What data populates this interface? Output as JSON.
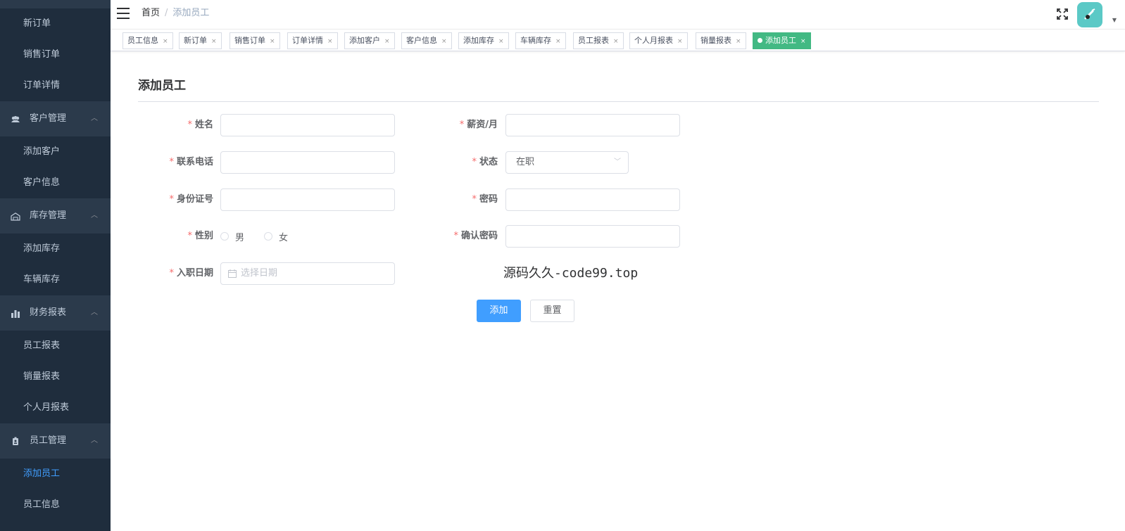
{
  "sidebar": {
    "items_top": [
      {
        "label": "新订单"
      },
      {
        "label": "销售订单"
      },
      {
        "label": "订单详情"
      }
    ],
    "group_customer": {
      "label": "客户管理",
      "icon": "users-icon"
    },
    "customer_items": [
      {
        "label": "添加客户"
      },
      {
        "label": "客户信息"
      }
    ],
    "group_inventory": {
      "label": "库存管理",
      "icon": "warehouse-icon"
    },
    "inventory_items": [
      {
        "label": "添加库存"
      },
      {
        "label": "车辆库存"
      }
    ],
    "group_finance": {
      "label": "财务报表",
      "icon": "bar-chart-icon"
    },
    "finance_items": [
      {
        "label": "员工报表"
      },
      {
        "label": "销量报表"
      },
      {
        "label": "个人月报表"
      }
    ],
    "group_employee": {
      "label": "员工管理",
      "icon": "badge-icon"
    },
    "employee_items": [
      {
        "label": "添加员工",
        "active": true
      },
      {
        "label": "员工信息"
      }
    ]
  },
  "navbar": {
    "breadcrumb_home": "首页",
    "breadcrumb_sep": "/",
    "breadcrumb_current": "添加员工"
  },
  "tags": [
    {
      "label": "员工信息",
      "close": "×"
    },
    {
      "label": "新订单",
      "close": "×"
    },
    {
      "label": "销售订单",
      "close": "×"
    },
    {
      "label": "订单详情",
      "close": "×"
    },
    {
      "label": "添加客户",
      "close": "×"
    },
    {
      "label": "客户信息",
      "close": "×"
    },
    {
      "label": "添加库存",
      "close": "×"
    },
    {
      "label": "车辆库存",
      "close": "×"
    },
    {
      "label": "员工报表",
      "close": "×"
    },
    {
      "label": "个人月报表",
      "close": "×"
    },
    {
      "label": "销量报表",
      "close": "×"
    },
    {
      "label": "添加员工",
      "close": "×",
      "active": true
    }
  ],
  "form": {
    "title": "添加员工",
    "required_mark": "*",
    "name_label": "姓名",
    "name_value": "",
    "phone_label": "联系电话",
    "phone_value": "",
    "id_label": "身份证号",
    "id_value": "",
    "gender_label": "性别",
    "gender_male": "男",
    "gender_female": "女",
    "hire_date_label": "入职日期",
    "hire_date_placeholder": "选择日期",
    "salary_label": "薪资/月",
    "salary_value": "",
    "status_label": "状态",
    "status_value": "在职",
    "password_label": "密码",
    "password_value": "",
    "confirm_label": "确认密码",
    "confirm_value": "",
    "submit_label": "添加",
    "reset_label": "重置"
  },
  "watermark": "源码久久-code99.top",
  "colors": {
    "sidebar_bg": "#1f2d3d",
    "sidebar_group_bg": "#2b3a4b",
    "active_link": "#409eff",
    "active_tag": "#42b983",
    "primary_button": "#409eff",
    "required": "#f56c6c"
  }
}
